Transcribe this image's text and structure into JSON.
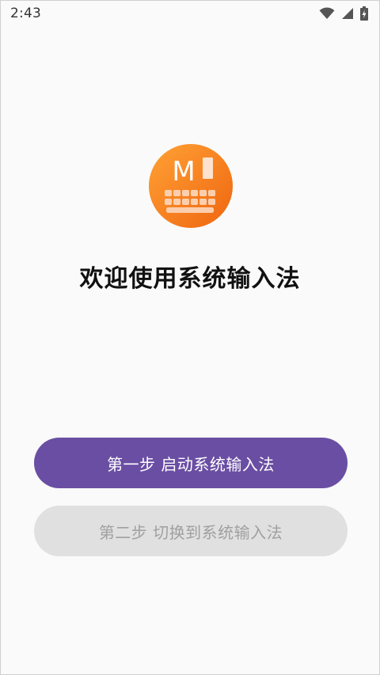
{
  "status_bar": {
    "time": "2:43",
    "icons": [
      "wifi-icon",
      "cellular-signal-icon",
      "battery-charging-icon"
    ]
  },
  "logo": {
    "letter": "M",
    "colors": {
      "gradient_start": "#ff9a2e",
      "gradient_end": "#f06a12"
    }
  },
  "welcome": {
    "title": "欢迎使用系统输入法"
  },
  "actions": {
    "step1_label": "第一步 启动系统输入法",
    "step2_label": "第二步 切换到系统输入法"
  },
  "colors": {
    "primary": "#6a4ea3",
    "disabled_bg": "#e0e0e0",
    "disabled_text": "#a0a0a0"
  }
}
